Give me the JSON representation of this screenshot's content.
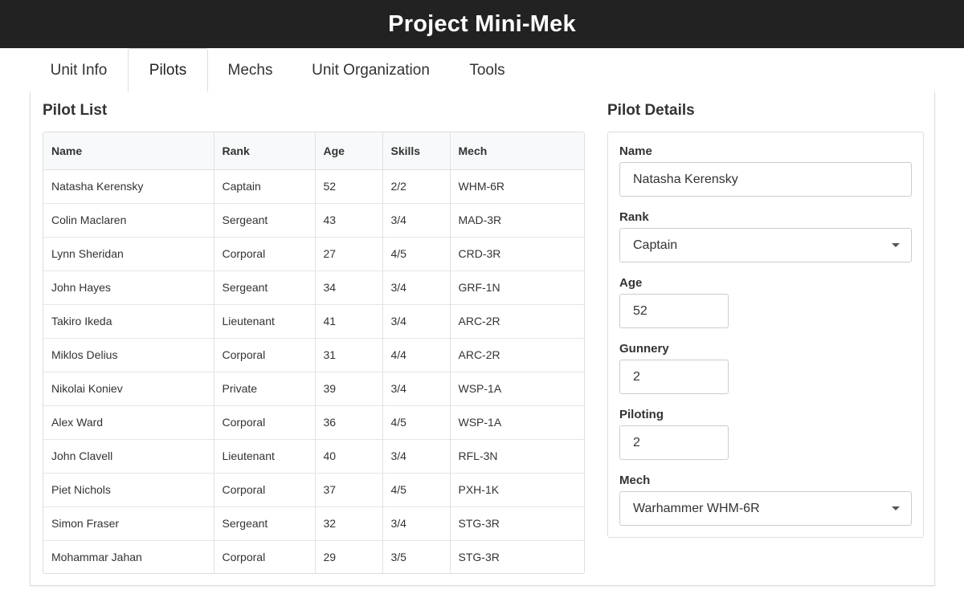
{
  "header": {
    "title": "Project Mini-Mek"
  },
  "tabs": [
    {
      "label": "Unit Info"
    },
    {
      "label": "Pilots"
    },
    {
      "label": "Mechs"
    },
    {
      "label": "Unit Organization"
    },
    {
      "label": "Tools"
    }
  ],
  "active_tab": "Pilots",
  "pilot_list": {
    "title": "Pilot List",
    "columns": [
      "Name",
      "Rank",
      "Age",
      "Skills",
      "Mech"
    ],
    "rows": [
      [
        "Natasha Kerensky",
        "Captain",
        "52",
        "2/2",
        "WHM-6R"
      ],
      [
        "Colin Maclaren",
        "Sergeant",
        "43",
        "3/4",
        "MAD-3R"
      ],
      [
        "Lynn Sheridan",
        "Corporal",
        "27",
        "4/5",
        "CRD-3R"
      ],
      [
        "John Hayes",
        "Sergeant",
        "34",
        "3/4",
        "GRF-1N"
      ],
      [
        "Takiro Ikeda",
        "Lieutenant",
        "41",
        "3/4",
        "ARC-2R"
      ],
      [
        "Miklos Delius",
        "Corporal",
        "31",
        "4/4",
        "ARC-2R"
      ],
      [
        "Nikolai Koniev",
        "Private",
        "39",
        "3/4",
        "WSP-1A"
      ],
      [
        "Alex Ward",
        "Corporal",
        "36",
        "4/5",
        "WSP-1A"
      ],
      [
        "John Clavell",
        "Lieutenant",
        "40",
        "3/4",
        "RFL-3N"
      ],
      [
        "Piet Nichols",
        "Corporal",
        "37",
        "4/5",
        "PXH-1K"
      ],
      [
        "Simon Fraser",
        "Sergeant",
        "32",
        "3/4",
        "STG-3R"
      ],
      [
        "Mohammar Jahan",
        "Corporal",
        "29",
        "3/5",
        "STG-3R"
      ]
    ]
  },
  "pilot_details": {
    "title": "Pilot Details",
    "name_label": "Name",
    "name_value": "Natasha Kerensky",
    "rank_label": "Rank",
    "rank_value": "Captain",
    "age_label": "Age",
    "age_value": "52",
    "gunnery_label": "Gunnery",
    "gunnery_value": "2",
    "piloting_label": "Piloting",
    "piloting_value": "2",
    "mech_label": "Mech",
    "mech_value": "Warhammer WHM-6R"
  },
  "colors": {
    "header_bg": "#222222",
    "border": "#dddddd",
    "table_header_bg": "#f8f9fa"
  }
}
